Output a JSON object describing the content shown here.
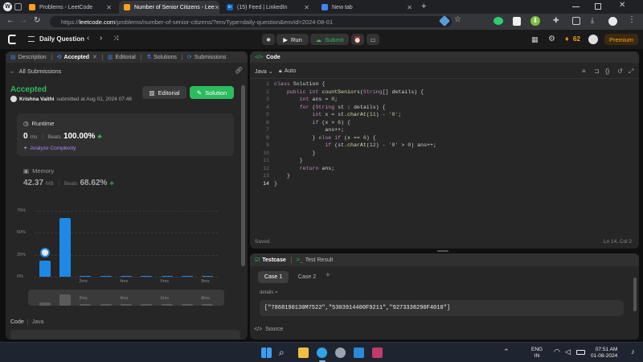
{
  "browser": {
    "tabs": [
      {
        "label": "Problems - LeetCode",
        "fav_color": "#ffa116"
      },
      {
        "label": "Number of Senior Citizens - Lee",
        "fav_color": "#ffa116",
        "active": true
      },
      {
        "label": "(15) Feed | LinkedIn",
        "fav_color": "#0a66c2",
        "fav_text": "in"
      },
      {
        "label": "New tab",
        "fav_color": "#4285f4"
      }
    ],
    "new_tab": "+",
    "url_domain": "leetcode.com",
    "url_prefix": "https://",
    "url_rest": "/problems/number-of-senior-citizens/?envType=daily-question&envId=2024-08-01"
  },
  "nav": {
    "title": "Daily Question",
    "run": "Run",
    "submit": "Submit",
    "streak": "62",
    "premium": "Premium"
  },
  "left": {
    "tabs": [
      "Description",
      "Accepted",
      "Editorial",
      "Solutions",
      "Submissions"
    ],
    "all_submissions": "All Submissions",
    "status": "Accepted",
    "user": "Krishna Vaithi",
    "submitted_at": "submitted at Aug 01, 2024 07:46",
    "editorial_btn": "Editorial",
    "solution_btn": "Solution",
    "runtime": {
      "label": "Runtime",
      "value": "0",
      "unit": "ms",
      "beats_label": "Beats",
      "beats": "100.00%",
      "analyze": "Analyze Complexity"
    },
    "memory": {
      "label": "Memory",
      "value": "42.37",
      "unit": "MB",
      "beats_label": "Beats",
      "beats": "68.62%"
    },
    "chart_yticks": [
      "75%",
      "50%",
      "25%",
      "0%"
    ],
    "chart_xticks": [
      "2ms",
      "4ms",
      "6ms",
      "8ms"
    ],
    "code_label": "Code",
    "code_lang": "Java"
  },
  "chart_data": {
    "type": "bar",
    "title": "",
    "xlabel": "",
    "ylabel": "",
    "ylim": [
      0,
      75
    ],
    "categories": [
      "0ms",
      "1ms",
      "2ms",
      "3ms",
      "4ms",
      "5ms",
      "6ms",
      "7ms",
      "8ms"
    ],
    "values": [
      18,
      67,
      1,
      1,
      1,
      1,
      1,
      1,
      1
    ],
    "yticks": [
      "75%",
      "50%",
      "25%",
      "0%"
    ],
    "xticks": [
      "2ms",
      "4ms",
      "6ms",
      "8ms"
    ],
    "color": "#1e88e5"
  },
  "editor": {
    "header": "Code",
    "lang": "Java",
    "mode": "Auto",
    "status_left": "Saved",
    "status_right": "Ln 14, Col 2",
    "lines": [
      "class Solution {",
      "    public int countSeniors(String[] details) {",
      "        int ans = 0;",
      "        for (String st : details) {",
      "            int x = st.charAt(11) - '0';",
      "            if (x > 6) {",
      "                ans++;",
      "            } else if (x == 6) {",
      "                if (st.charAt(12) - '0' > 0) ans++;",
      "            }",
      "        }",
      "        return ans;",
      "    }",
      "}"
    ]
  },
  "testcase": {
    "tab1": "Testcase",
    "tab2": "Test Result",
    "case1": "Case 1",
    "case2": "Case 2",
    "add": "+",
    "param": "details =",
    "value": "[\"7868190130M7522\",\"5303914400F9211\",\"9273338290F4010\"]",
    "source": "Source"
  },
  "taskbar": {
    "lang": "ENG",
    "region": "IN",
    "time": "07:51 AM",
    "date": "01-08-2024"
  }
}
